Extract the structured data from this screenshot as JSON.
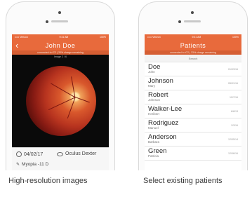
{
  "left_screen": {
    "status": {
      "carrier": "••••• Verizon",
      "time": "9:41 AM",
      "battery": "100%"
    },
    "nav_title": "John Doe",
    "connection": "connected to iC2 | 33% charge remaining",
    "image_count": "Image 2 / 6",
    "info": {
      "date": "04/02/17",
      "eye": "Oculus Dexter",
      "note": "Myopia -11 D"
    }
  },
  "right_screen": {
    "status": {
      "carrier": "••••• Verizon",
      "time": "9:41 AM",
      "battery": "100%"
    },
    "nav_title": "Patients",
    "connection": "connected to iC2 | 33% charge remaining",
    "search_placeholder": "Search",
    "patients": [
      {
        "last": "Doe",
        "first": "John",
        "date": "01/03/16"
      },
      {
        "last": "Johnson",
        "first": "Mary",
        "date": "05/01/16"
      },
      {
        "last": "Robert",
        "first": "Johnson",
        "date": "10/7/16"
      },
      {
        "last": "Walker-Lee",
        "first": "Heribert",
        "date": "6/8/13"
      },
      {
        "last": "Rodriguez",
        "first": "Manuel",
        "date": "1/3/16"
      },
      {
        "last": "Anderson",
        "first": "Barbara",
        "date": "12/05/14"
      },
      {
        "last": "Green",
        "first": "Patricia",
        "date": "12/06/16"
      }
    ]
  },
  "captions": {
    "left": "High-resolution images",
    "right": "Select existing patients"
  },
  "colors": {
    "accent": "#e86a3c",
    "accent_dark": "#d55e33"
  }
}
